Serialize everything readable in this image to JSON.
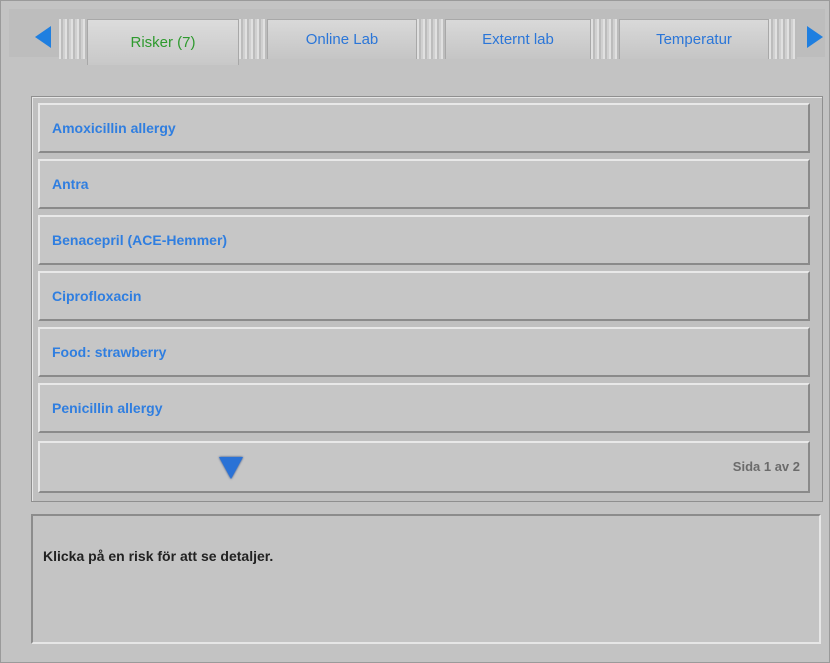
{
  "tabs": [
    {
      "label": "Risker (7)",
      "active": true
    },
    {
      "label": "Online Lab",
      "active": false
    },
    {
      "label": "Externt lab",
      "active": false
    },
    {
      "label": "Temperatur",
      "active": false
    }
  ],
  "nav": {
    "prev_icon": "triangle-left-icon",
    "next_icon": "triangle-right-icon"
  },
  "risks": [
    {
      "label": "Amoxicillin allergy"
    },
    {
      "label": "Antra"
    },
    {
      "label": "Benacepril (ACE-Hemmer)"
    },
    {
      "label": "Ciprofloxacin"
    },
    {
      "label": "Food: strawberry"
    },
    {
      "label": "Penicillin allergy"
    }
  ],
  "pager": {
    "text": "Sida 1 av 2",
    "down_icon": "triangle-down-icon"
  },
  "detail": {
    "hint": "Klicka på en risk för att se detaljer."
  },
  "colors": {
    "accent": "#1f7fe0",
    "active_tab": "#2e9a2e",
    "background": "#c3c3c3"
  }
}
